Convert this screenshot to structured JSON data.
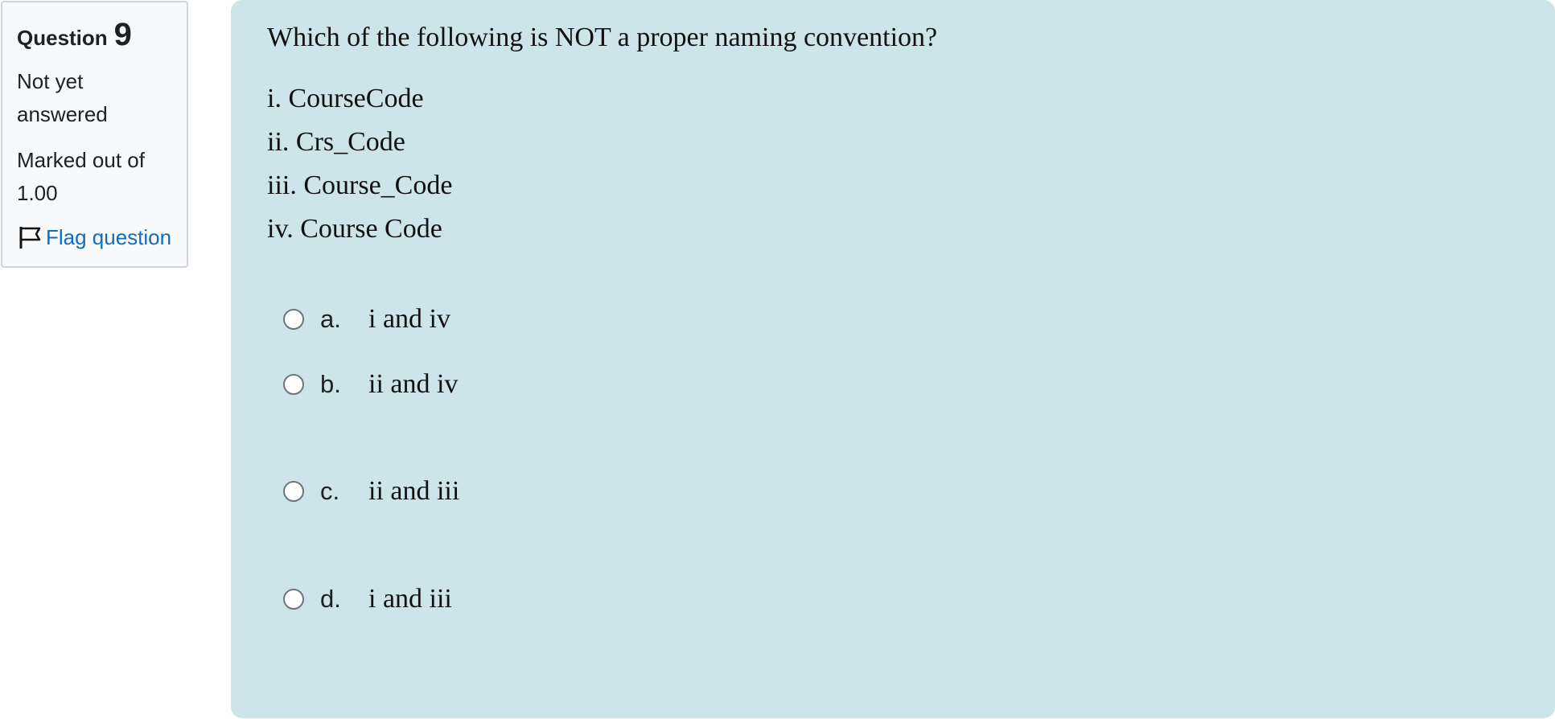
{
  "info": {
    "question_label": "Question",
    "question_number": "9",
    "state": "Not yet answered",
    "grade": "Marked out of 1.00",
    "flag_label": "Flag question",
    "flag_icon": "flag-icon"
  },
  "question": {
    "text": "Which of the following is NOT a proper naming convention?",
    "items": [
      "i. CourseCode",
      "ii. Crs_Code",
      "iii. Course_Code",
      "iv. Course Code"
    ],
    "options": [
      {
        "letter": "a.",
        "text": "i and iv"
      },
      {
        "letter": "b.",
        "text": "ii and iv"
      },
      {
        "letter": "c.",
        "text": "ii and iii"
      },
      {
        "letter": "d.",
        "text": "i and iii"
      }
    ]
  },
  "colors": {
    "panel_bg": "#cde5ea",
    "info_bg": "#f8f9fa",
    "link": "#0f6cbf"
  }
}
